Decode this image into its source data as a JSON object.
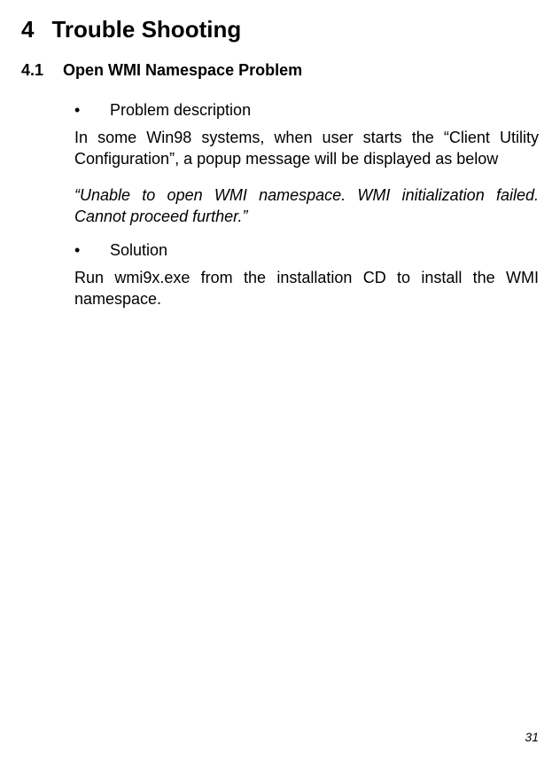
{
  "chapter": {
    "number": "4",
    "title": "Trouble Shooting"
  },
  "section": {
    "number": "4.1",
    "title": "Open WMI Namespace Problem"
  },
  "content": {
    "bullet1_label": "Problem description",
    "paragraph1": "In some Win98 systems, when user starts the “Client Utility Configuration”, a popup message will be displayed as below",
    "paragraph2": "“Unable to open WMI namespace. WMI initialization failed. Cannot proceed further.”",
    "bullet2_label": "Solution",
    "paragraph3": "Run wmi9x.exe from the installation CD to install the WMI namespace."
  },
  "page_number": "31",
  "bullet_glyph": "•"
}
